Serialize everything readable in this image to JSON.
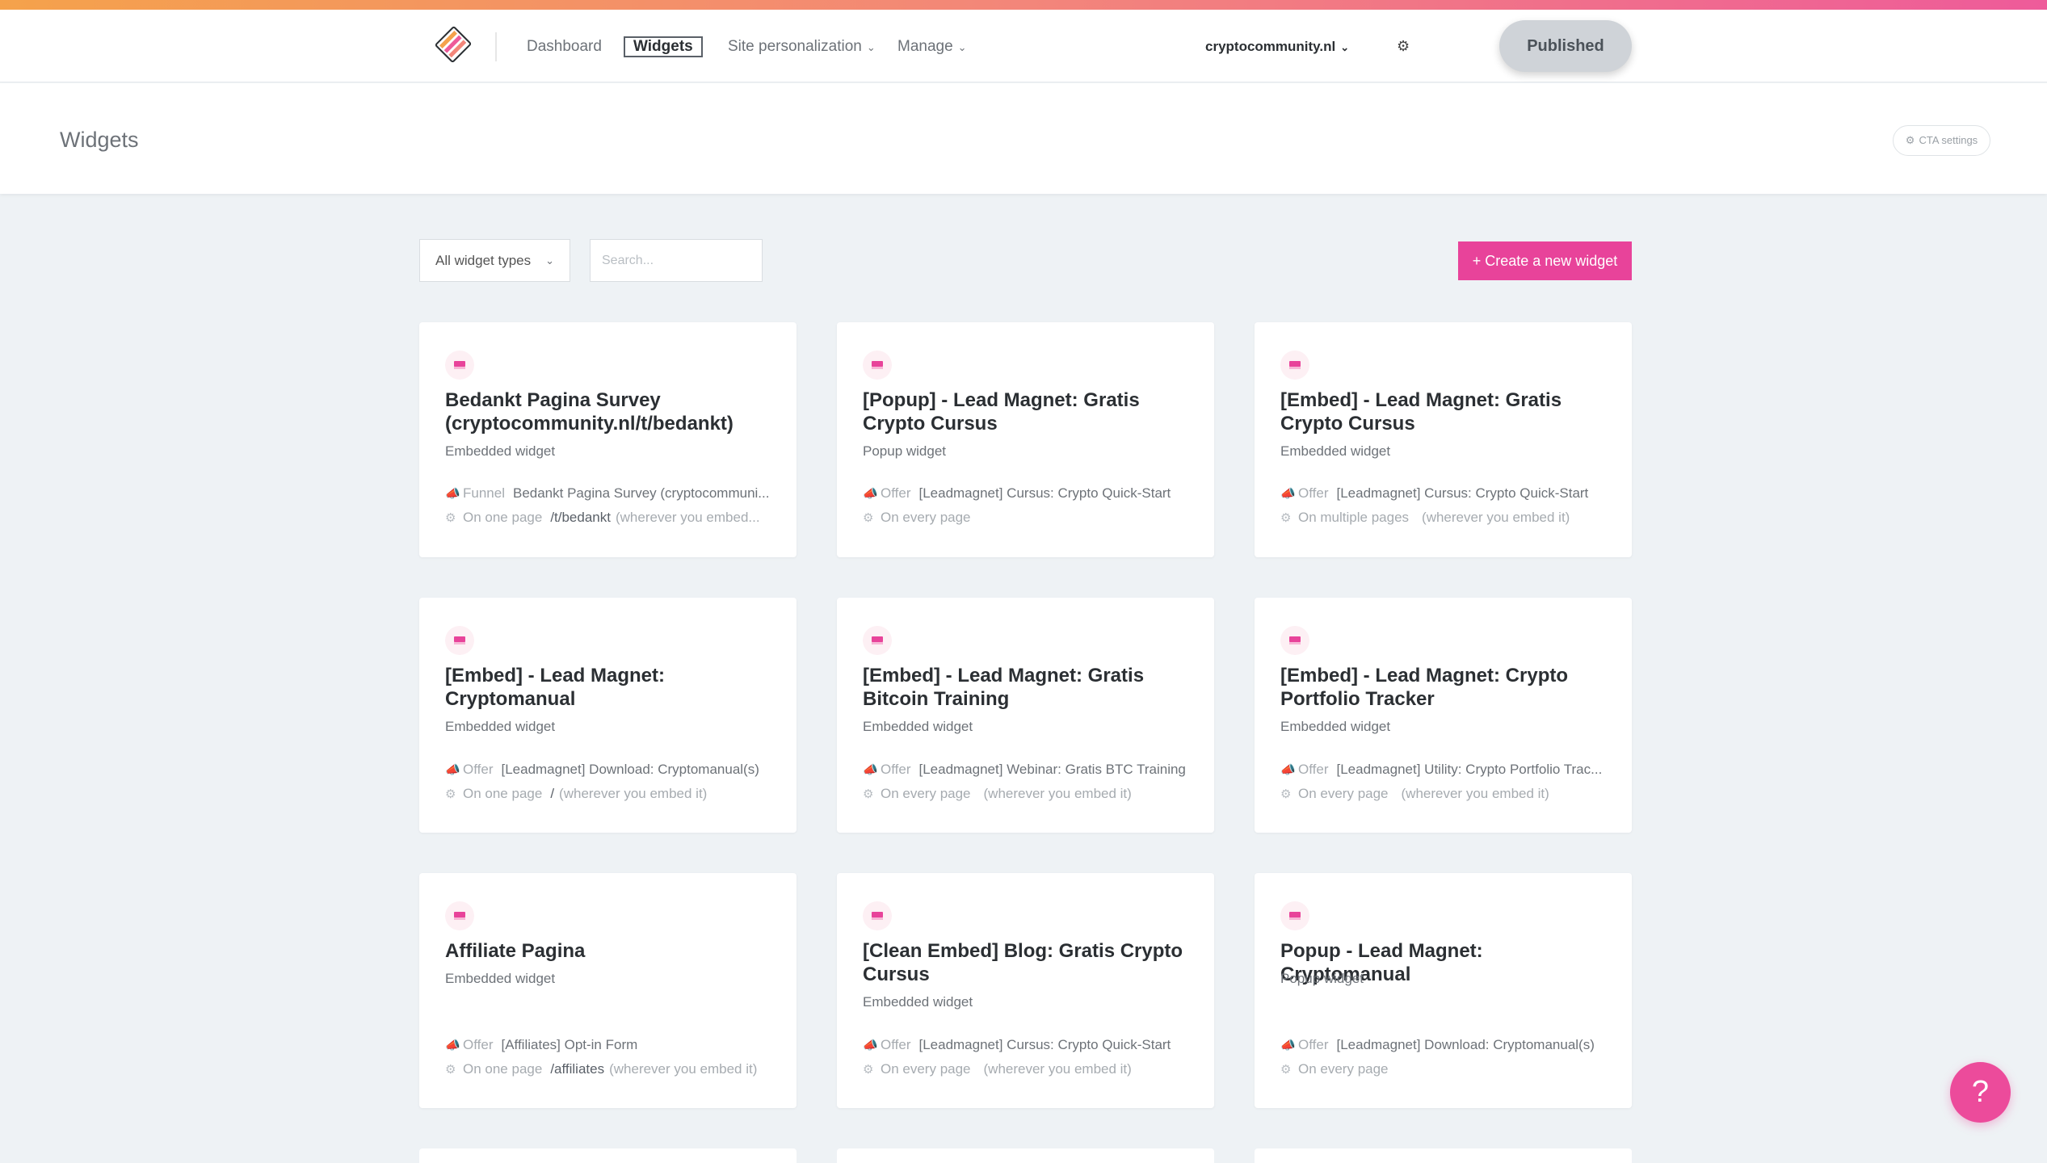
{
  "nav": {
    "dashboard": "Dashboard",
    "widgets": "Widgets",
    "site_personalization": "Site personalization",
    "manage": "Manage",
    "site": "cryptocommunity.nl",
    "published": "Published"
  },
  "header": {
    "title": "Widgets",
    "cta_settings": "CTA settings"
  },
  "toolbar": {
    "filter": "All widget types",
    "search_placeholder": "Search...",
    "create": "+ Create a new widget"
  },
  "cards": [
    {
      "title": "Bedankt Pagina Survey (cryptocommunity.nl/t/bedankt)",
      "type": "Embedded widget",
      "key1": "Funnel",
      "val1": "Bedankt Pagina Survey (cryptocommuni...",
      "key2": "On one page",
      "path2": "/t/bedankt",
      "note2": "(wherever you embed..."
    },
    {
      "title": "[Popup] - Lead Magnet: Gratis Crypto Cursus",
      "type": "Popup widget",
      "key1": "Offer",
      "val1": "[Leadmagnet] Cursus: Crypto Quick-Start",
      "key2": "On every page",
      "path2": "",
      "note2": ""
    },
    {
      "title": "[Embed] - Lead Magnet: Gratis Crypto Cursus",
      "type": "Embedded widget",
      "key1": "Offer",
      "val1": "[Leadmagnet] Cursus: Crypto Quick-Start",
      "key2": "On multiple pages",
      "path2": "",
      "note2": "(wherever you embed it)"
    },
    {
      "title": "[Embed] - Lead Magnet: Cryptomanual",
      "type": "Embedded widget",
      "key1": "Offer",
      "val1": "[Leadmagnet] Download: Cryptomanual(s)",
      "key2": "On one page",
      "path2": "/",
      "note2": "(wherever you embed it)"
    },
    {
      "title": "[Embed] - Lead Magnet: Gratis Bitcoin Training",
      "type": "Embedded widget",
      "key1": "Offer",
      "val1": "[Leadmagnet] Webinar: Gratis BTC Training",
      "key2": "On every page",
      "path2": "",
      "note2": "(wherever you embed it)"
    },
    {
      "title": "[Embed] - Lead Magnet: Crypto Portfolio Tracker",
      "type": "Embedded widget",
      "key1": "Offer",
      "val1": "[Leadmagnet] Utility: Crypto Portfolio Trac...",
      "key2": "On every page",
      "path2": "",
      "note2": "(wherever you embed it)"
    },
    {
      "title": "Affiliate Pagina",
      "type": "Embedded widget",
      "key1": "Offer",
      "val1": "[Affiliates] Opt-in Form",
      "key2": "On one page",
      "path2": "/affiliates",
      "note2": "(wherever you embed it)"
    },
    {
      "title": "[Clean Embed] Blog: Gratis Crypto Cursus",
      "type": "Embedded widget",
      "key1": "Offer",
      "val1": "[Leadmagnet] Cursus: Crypto Quick-Start",
      "key2": "On every page",
      "path2": "",
      "note2": "(wherever you embed it)"
    },
    {
      "title": "Popup - Lead Magnet: Cryptomanual",
      "type": "Popup widget",
      "key1": "Offer",
      "val1": "[Leadmagnet] Download: Cryptomanual(s)",
      "key2": "On every page",
      "path2": "",
      "note2": ""
    }
  ],
  "help": "?"
}
